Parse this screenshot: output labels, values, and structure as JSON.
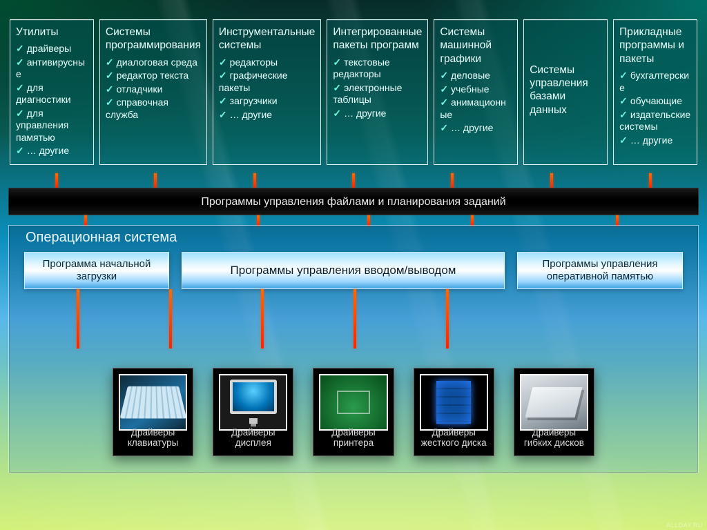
{
  "categories": [
    {
      "title": "Утилиты",
      "items": [
        "драйверы",
        "антивирусные",
        "для диагностики",
        "для управления памятью",
        "… другие"
      ]
    },
    {
      "title": "Системы программирования",
      "items": [
        "диалоговая среда",
        "редактор текста",
        "отладчики",
        "справочная служба"
      ]
    },
    {
      "title": "Инструментальные системы",
      "items": [
        "редакторы",
        "графические пакеты",
        "загрузчики",
        "… другие"
      ]
    },
    {
      "title": "Интегрированные пакеты программ",
      "items": [
        "текстовые редакторы",
        "электронные таблицы",
        "… другие"
      ]
    },
    {
      "title": "Системы машинной графики",
      "items": [
        "деловые",
        "учебные",
        "анимационные",
        "… другие"
      ]
    },
    {
      "title": "Системы управления базами данных",
      "items": []
    },
    {
      "title": "Прикладные программы и пакеты",
      "items": [
        "бухгалтерские",
        "обучающие",
        "издательские системы",
        "… другие"
      ]
    }
  ],
  "file_bar": "Программы управления файлами и планирования заданий",
  "os_title": "Операционная система",
  "mid_row": {
    "bootstrap": "Программа начальной загрузки",
    "io": "Программы управления вводом/выводом",
    "ram": "Программы управления оперативной памятью"
  },
  "drivers": [
    "Драйверы клавиатуры",
    "Драйверы дисплея",
    "Драйверы принтера",
    "Драйверы жесткого диска",
    "Драйверы гибких дисков"
  ],
  "watermark": "ALLDAY.RU"
}
